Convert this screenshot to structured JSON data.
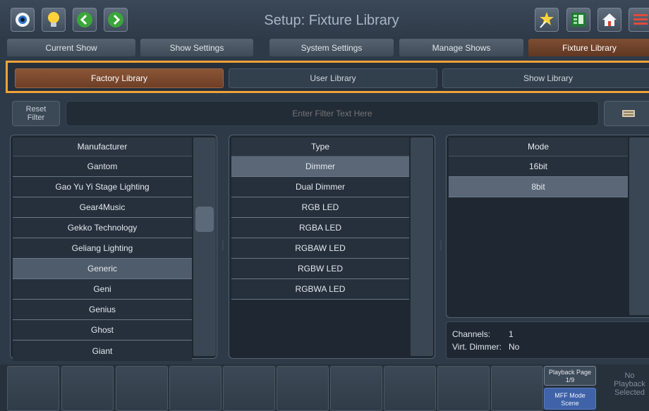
{
  "header": {
    "title": "Setup: Fixture Library",
    "left_icons": [
      "eye-icon",
      "lightbulb-icon",
      "back-arrow-icon",
      "forward-arrow-icon"
    ],
    "right_icons": [
      "wizard-icon",
      "grid-icon",
      "home-icon",
      "menu-icon"
    ]
  },
  "tabs": [
    {
      "label": "Current Show"
    },
    {
      "label": "Show Settings"
    },
    {
      "label": "System Settings"
    },
    {
      "label": "Manage Shows"
    },
    {
      "label": "Fixture Library"
    }
  ],
  "library_tabs": [
    {
      "label": "Factory Library"
    },
    {
      "label": "User Library"
    },
    {
      "label": "Show Library"
    }
  ],
  "filter": {
    "reset_line1": "Reset",
    "reset_line2": "Filter",
    "placeholder": "Enter Filter Text Here"
  },
  "manufacturer": {
    "header": "Manufacturer",
    "items": [
      "Gantom",
      "Gao Yu Yi Stage Lighting",
      "Gear4Music",
      "Gekko Technology",
      "Geliang Lighting",
      "Generic",
      "Geni",
      "Genius",
      "Ghost",
      "Giant"
    ],
    "selected": "Generic"
  },
  "type": {
    "header": "Type",
    "items": [
      "Dimmer",
      "Dual Dimmer",
      "RGB LED",
      "RGBA LED",
      "RGBAW LED",
      "RGBW LED",
      "RGBWA LED"
    ],
    "selected": "Dimmer"
  },
  "mode": {
    "header": "Mode",
    "items": [
      "16bit",
      "8bit"
    ],
    "selected": "8bit"
  },
  "info": {
    "channels_label": "Channels:",
    "channels_value": "1",
    "virt_dimmer_label": "Virt. Dimmer:",
    "virt_dimmer_value": "No"
  },
  "bottom": {
    "playback_page_label": "Playback Page",
    "playback_page_value": "1/9",
    "mff_label": "MFF Mode",
    "mff_value": "Scene",
    "no_playback_1": "No",
    "no_playback_2": "Playback",
    "no_playback_3": "Selected"
  },
  "colors": {
    "accent_orange": "#f0a238",
    "active_tab_brown": "#7e4e33",
    "mff_blue": "#3f62a8"
  }
}
